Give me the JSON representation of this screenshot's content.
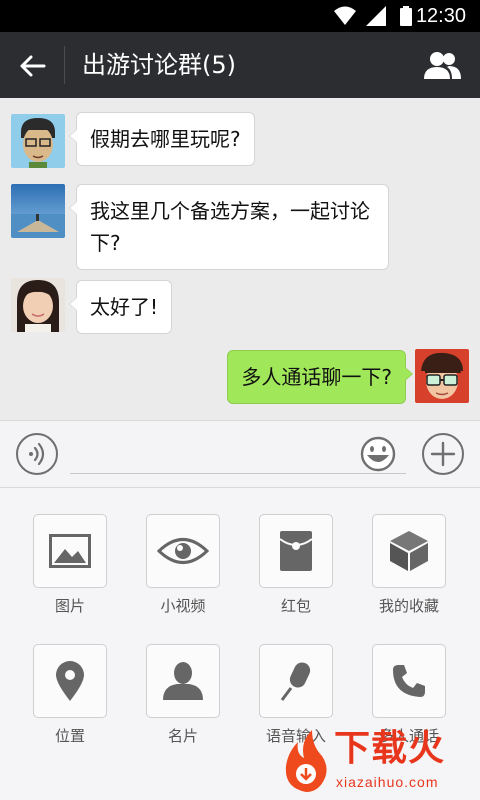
{
  "status_bar": {
    "time": "12:30"
  },
  "header": {
    "title": "出游讨论群(5)"
  },
  "messages": [
    {
      "side": "left",
      "text": "假期去哪里玩呢?",
      "avatar": "avatar-cartoon-glasses"
    },
    {
      "side": "left",
      "text": "我这里几个备选方案，一起讨论下?",
      "avatar": "avatar-lake-photo"
    },
    {
      "side": "left",
      "text": "太好了!",
      "avatar": "avatar-girl-photo"
    },
    {
      "side": "right",
      "text": "多人通话聊一下?",
      "avatar": "avatar-cartoon-boy"
    }
  ],
  "input_bar": {
    "value": "",
    "voice_icon": "voice-icon",
    "emoji_icon": "emoji-icon",
    "plus_icon": "plus-icon"
  },
  "tools": [
    {
      "label": "图片",
      "icon": "image-icon"
    },
    {
      "label": "小视频",
      "icon": "eye-icon"
    },
    {
      "label": "红包",
      "icon": "red-packet-icon"
    },
    {
      "label": "我的收藏",
      "icon": "cube-icon"
    },
    {
      "label": "位置",
      "icon": "location-pin-icon"
    },
    {
      "label": "名片",
      "icon": "person-card-icon"
    },
    {
      "label": "语音输入",
      "icon": "microphone-icon"
    },
    {
      "label": "多人通话",
      "icon": "phone-icon"
    }
  ],
  "watermark": {
    "text": "下载火",
    "sub": "xiazaihuo.com"
  },
  "colors": {
    "header_bg": "#2b2d31",
    "sent_bubble": "#a0e75a",
    "watermark": "#e8361c"
  }
}
